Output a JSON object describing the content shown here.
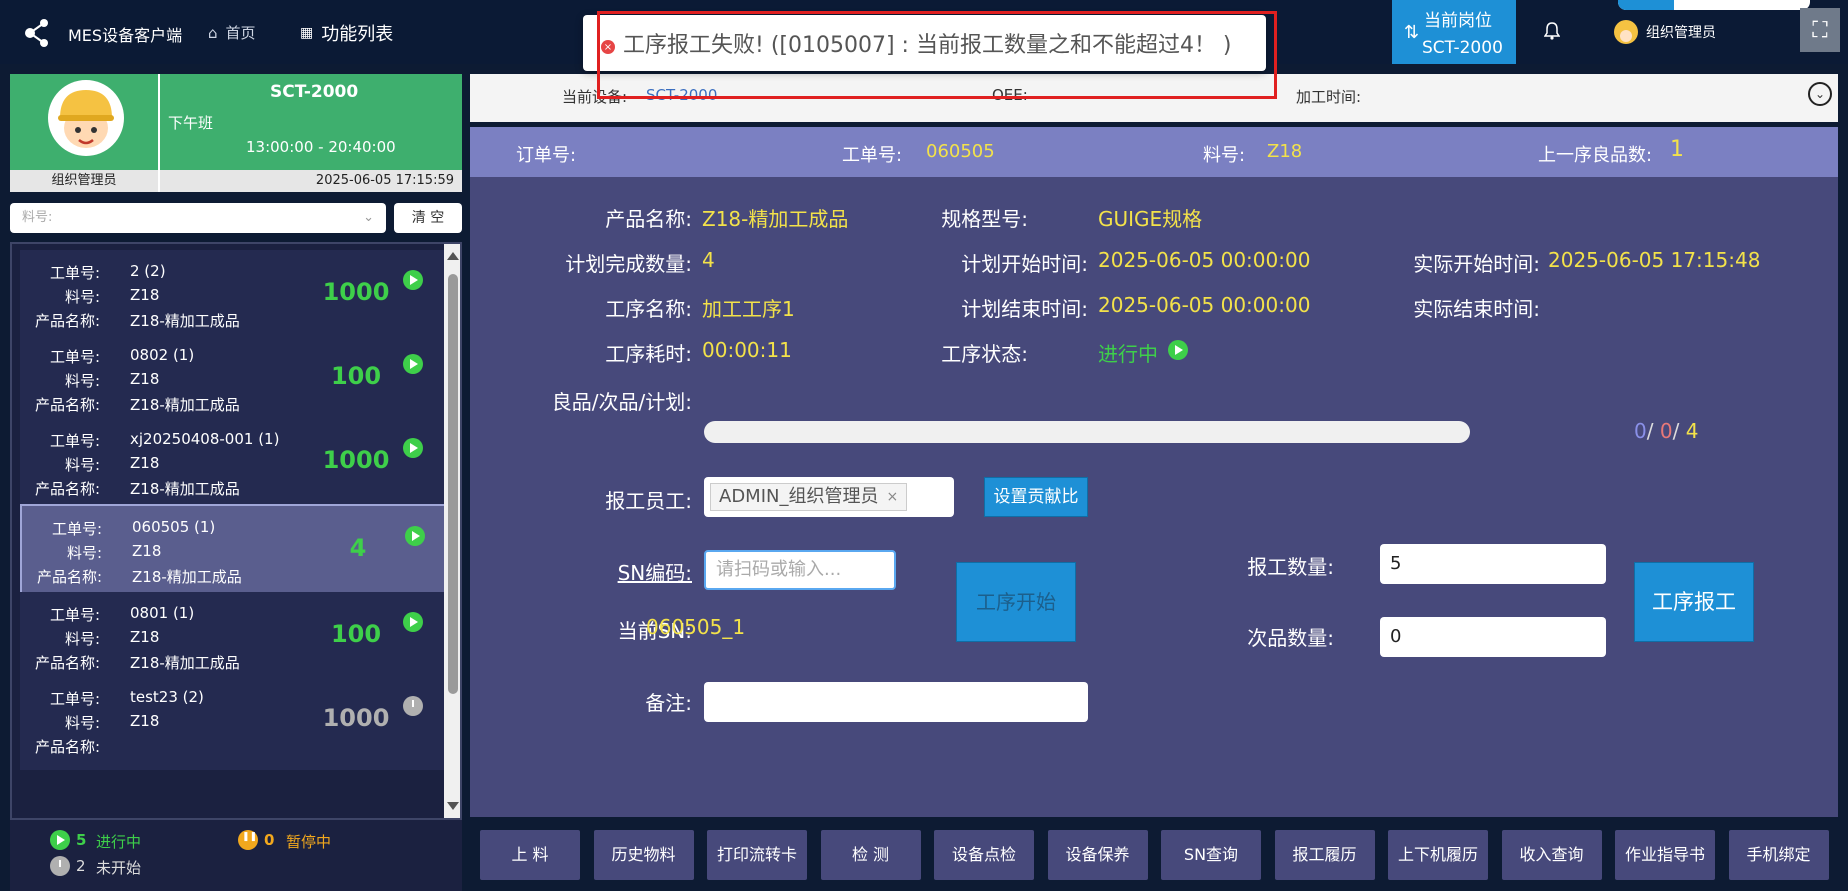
{
  "header": {
    "app_title": "MES设备客户端",
    "nav_home": "首页",
    "nav_functions": "功能列表",
    "post_label": "当前岗位",
    "post_value": "SCT-2000",
    "user_name": "组织管理员"
  },
  "toast": {
    "message": "工序报工失败! ([0105007] : 当前报工数量之和不能超过4！ )",
    "type": "error"
  },
  "profile": {
    "device": "SCT-2000",
    "shift": "下午班",
    "shift_time": "13:00:00 - 20:40:00",
    "user": "组织管理员",
    "datetime": "2025-06-05 17:15:59"
  },
  "filter": {
    "material_placeholder": "料号:",
    "clear_label": "清 空"
  },
  "card_labels": {
    "order": "工单号:",
    "material": "料号:",
    "product": "产品名称:"
  },
  "work_orders": [
    {
      "order": "2 (2)",
      "material": "Z18",
      "product": "Z18-精加工成品",
      "qty": "1000",
      "status": "running"
    },
    {
      "order": "0802 (1)",
      "material": "Z18",
      "product": "Z18-精加工成品",
      "qty": "100",
      "status": "running"
    },
    {
      "order": "xj20250408-001 (1)",
      "material": "Z18",
      "product": "Z18-精加工成品",
      "qty": "1000",
      "status": "running"
    },
    {
      "order": "060505 (1)",
      "material": "Z18",
      "product": "Z18-精加工成品",
      "qty": "4",
      "status": "running",
      "selected": true
    },
    {
      "order": "0801 (1)",
      "material": "Z18",
      "product": "Z18-精加工成品",
      "qty": "100",
      "status": "running"
    },
    {
      "order": "test23 (2)",
      "material": "Z18",
      "product": "",
      "qty": "1000",
      "status": "not-started"
    }
  ],
  "status_summary": {
    "running_count": "5",
    "running_label": "进行中",
    "paused_count": "0",
    "paused_label": "暂停中",
    "not_started_count": "2",
    "not_started_label": "未开始"
  },
  "info_strip": {
    "device_label": "当前设备:",
    "device_value": "SCT-2000",
    "oee_label": "OEE:",
    "process_time_label": "加工时间:"
  },
  "order_bar": {
    "order_label": "订单号:",
    "work_order_label": "工单号:",
    "work_order_value": "060505",
    "material_label": "料号:",
    "material_value": "Z18",
    "prev_good_label": "上一序良品数:",
    "prev_good_value": "1"
  },
  "details": {
    "product_name_label": "产品名称:",
    "product_name": "Z18-精加工成品",
    "spec_label": "规格型号:",
    "spec": "GUIGE规格",
    "plan_qty_label": "计划完成数量:",
    "plan_qty": "4",
    "plan_start_label": "计划开始时间:",
    "plan_start": "2025-06-05 00:00:00",
    "actual_start_label": "实际开始时间:",
    "actual_start": "2025-06-05 17:15:48",
    "process_name_label": "工序名称:",
    "process_name": "加工工序1",
    "plan_end_label": "计划结束时间:",
    "plan_end": "2025-06-05 00:00:00",
    "actual_end_label": "实际结束时间:",
    "actual_end": "",
    "duration_label": "工序耗时:",
    "duration": "00:00:11",
    "process_status_label": "工序状态:",
    "process_status": "进行中",
    "progress_label": "良品/次品/计划:",
    "progress_good": "0",
    "progress_bad": "0",
    "progress_plan": "4",
    "progress_fraction": 0,
    "employee_label": "报工员工:",
    "employee_tag": "ADMIN_组织管理员",
    "set_ratio_label": "设置贡献比",
    "sn_label": "SN编码:",
    "sn_placeholder": "请扫码或输入...",
    "start_process_label": "工序开始",
    "current_sn_label": "当前SN:",
    "current_sn": "060505_1",
    "report_qty_label": "报工数量:",
    "report_qty": "5",
    "defect_qty_label": "次品数量:",
    "defect_qty": "0",
    "report_button_label": "工序报工",
    "remark_label": "备注:",
    "remark": ""
  },
  "footer_buttons": [
    "上 料",
    "历史物料",
    "打印流转卡",
    "检 测",
    "设备点检",
    "设备保养",
    "SN查询",
    "报工履历",
    "上下机履历",
    "收入查询",
    "作业指导书",
    "手机绑定"
  ],
  "colors": {
    "accent": "#1e90d6",
    "profile_green": "#3eaf6e",
    "value_yellow": "#f3e24a",
    "status_green": "#3ecf4a",
    "error_red": "#e64545"
  }
}
